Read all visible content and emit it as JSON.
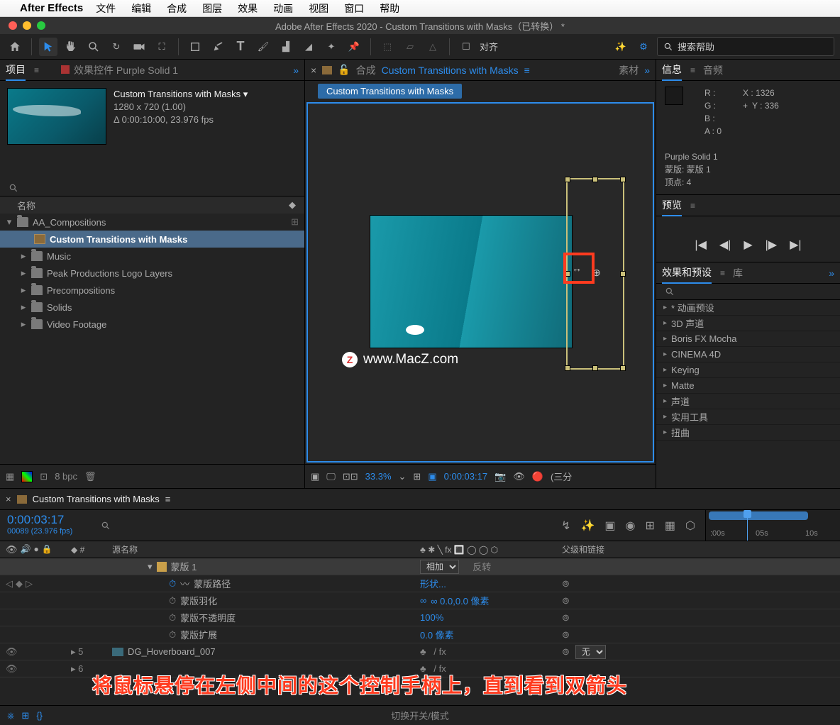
{
  "mac_menu": {
    "app": "After Effects",
    "items": [
      "文件",
      "编辑",
      "合成",
      "图层",
      "效果",
      "动画",
      "视图",
      "窗口",
      "帮助"
    ]
  },
  "title": "Adobe After Effects 2020 - Custom Transitions with Masks（已转换） *",
  "toolbar": {
    "snap_label": "对齐",
    "search_placeholder": "搜索帮助"
  },
  "project": {
    "tab_project": "项目",
    "tab_effect_controls": "效果控件 Purple Solid 1",
    "comp_name": "Custom Transitions with Masks ▾",
    "resolution": "1280 x 720 (1.00)",
    "duration": "Δ 0:00:10:00, 23.976 fps",
    "search_ph": "",
    "col_name": "名称",
    "tree": [
      {
        "type": "folder",
        "label": "AA_Compositions",
        "open": true,
        "selected": false
      },
      {
        "type": "comp",
        "label": "Custom Transitions with Masks",
        "selected": true,
        "indent": 2
      },
      {
        "type": "folder",
        "label": "Music"
      },
      {
        "type": "folder",
        "label": "Peak Productions Logo Layers"
      },
      {
        "type": "folder",
        "label": "Precompositions"
      },
      {
        "type": "folder",
        "label": "Solids"
      },
      {
        "type": "folder",
        "label": "Video Footage"
      }
    ],
    "bpc": "8 bpc"
  },
  "composition": {
    "tab_label_prefix": "合成",
    "tab_label": "Custom Transitions with Masks",
    "tab_sources": "素材",
    "breadcrumb": "Custom Transitions with Masks",
    "watermark": "www.MacZ.com",
    "zoom": "33.3%",
    "time": "0:00:03:17",
    "res": "(三分"
  },
  "info": {
    "tab_info": "信息",
    "tab_audio": "音频",
    "r": "R :",
    "g": "G :",
    "b": "B :",
    "a": "A :   0",
    "x": "X : 1326",
    "y": "Y : 336",
    "layer": "Purple Solid 1",
    "mask": "蒙版: 蒙版 1",
    "vertex": "顶点: 4"
  },
  "preview": {
    "tab": "预览"
  },
  "effects": {
    "tab_effects": "效果和预设",
    "tab_lib": "库",
    "presets": [
      "* 动画预设",
      "3D 声道",
      "Boris FX Mocha",
      "CINEMA 4D",
      "Keying",
      "Matte",
      "声道",
      "实用工具",
      "扭曲"
    ]
  },
  "timeline": {
    "tab": "Custom Transitions with Masks",
    "time": "0:00:03:17",
    "frame": "00089 (23.976 fps)",
    "col_num": "#",
    "col_src": "源名称",
    "col_switches": "♣ ✱ ╲ fx 🔳 ◯ ◯ ⬡",
    "col_parent": "父级和链接",
    "ruler": [
      ":00s",
      "05s",
      "10s"
    ],
    "rows": [
      {
        "kind": "mask",
        "label": "蒙版 1",
        "mode": "相加",
        "invert": "反转"
      },
      {
        "kind": "prop",
        "label": "蒙版路径",
        "value": "形状...",
        "stopwatch": true,
        "anim": true,
        "kf": true
      },
      {
        "kind": "prop",
        "label": "蒙版羽化",
        "value": "∞ 0.0,0.0 像素",
        "link": true
      },
      {
        "kind": "prop",
        "label": "蒙版不透明度",
        "value": "100%"
      },
      {
        "kind": "prop",
        "label": "蒙版扩展",
        "value": "0.0 像素"
      },
      {
        "kind": "layer",
        "num": "5",
        "label": "DG_Hoverboard_007",
        "parent": "无",
        "color": "amber"
      },
      {
        "kind": "layer",
        "num": "6",
        "label": "",
        "parent": "",
        "color": "teal"
      }
    ],
    "footer": "切换开关/模式"
  },
  "annotation": "将鼠标悬停在左侧中间的这个控制手柄上，直到看到双箭头"
}
